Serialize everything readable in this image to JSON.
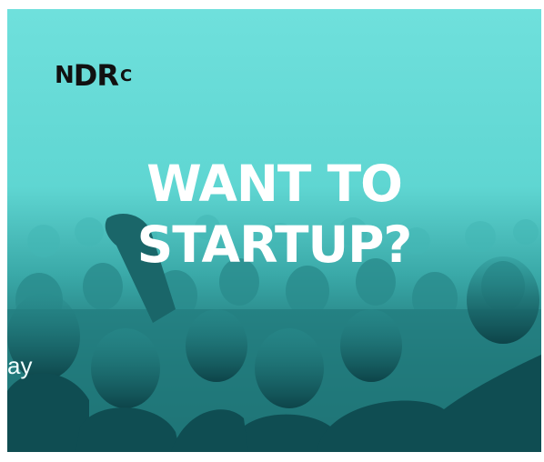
{
  "ad": {
    "logo_text": {
      "part_n": "N",
      "part_d": "D",
      "part_r": "R",
      "part_c": "C"
    },
    "headline_line1": "WANT TO",
    "headline_line2": "STARTUP?",
    "side_text": "ay"
  },
  "colors": {
    "banner_top": "#6fe0dc",
    "banner_bottom": "#0f4c52",
    "headline": "#ffffff",
    "logo": "#111111"
  }
}
